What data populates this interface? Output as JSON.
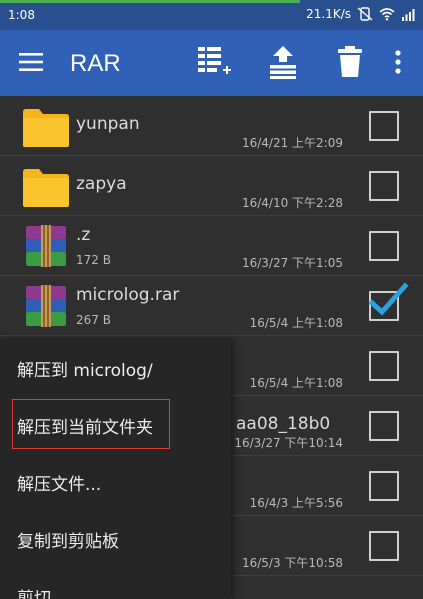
{
  "status_bar": {
    "time": "1:08",
    "net_speed": "21.1K/s",
    "icons": [
      "vibrate-off-icon",
      "wifi-icon",
      "signal-icon"
    ]
  },
  "app_bar": {
    "title": "RAR",
    "icons": [
      "menu-icon",
      "select-all-icon",
      "extract-icon",
      "delete-icon",
      "more-vert-icon"
    ]
  },
  "files": [
    {
      "name": "yunpan",
      "type": "folder",
      "size": "",
      "date": "16/4/21 上午2:09",
      "checked": false
    },
    {
      "name": "zapya",
      "type": "folder",
      "size": "",
      "date": "16/4/10 下午2:28",
      "checked": false
    },
    {
      "name": ".z",
      "type": "rar",
      "size": "172 B",
      "date": "16/3/27 下午1:05",
      "checked": false
    },
    {
      "name": "microlog.rar",
      "type": "rar",
      "size": "267 B",
      "date": "16/5/4 上午1:08",
      "checked": true
    },
    {
      "name": "",
      "type": "hidden",
      "size": "",
      "date": "16/5/4 上午1:08",
      "checked": false
    },
    {
      "name": "aa08_18b0",
      "type": "hidden",
      "size": "",
      "date": "16/3/27 下午10:14",
      "checked": false
    },
    {
      "name": "",
      "type": "hidden",
      "size": "",
      "date": "16/4/3 上午5:56",
      "checked": false
    },
    {
      "name": "",
      "type": "hidden",
      "size": "",
      "date": "16/5/3 下午10:58",
      "checked": false
    }
  ],
  "context_menu": {
    "items": [
      {
        "label": "解压到 microlog/"
      },
      {
        "label": "解压到当前文件夹"
      },
      {
        "label": "解压文件..."
      },
      {
        "label": "复制到剪贴板"
      },
      {
        "label": "剪切"
      }
    ]
  },
  "colors": {
    "app_bar": "#3061b6",
    "status_bar": "#2a4f8f",
    "folder": "#f5b51b",
    "check_accent": "#29a3e0",
    "highlight": "#e53935"
  }
}
